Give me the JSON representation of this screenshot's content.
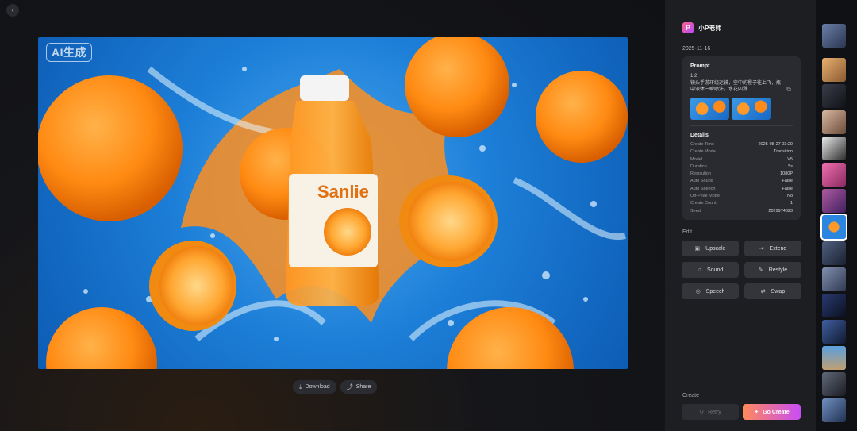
{
  "stage": {
    "watermark": "AI生成",
    "actions": [
      {
        "label": "Download",
        "icon": "download-icon"
      },
      {
        "label": "Share",
        "icon": "share-icon"
      }
    ],
    "packaging": "Sanlie"
  },
  "panel": {
    "user_name": "小P老师",
    "date": "2025-11-16",
    "prompt": {
      "heading": "Prompt",
      "ratio": "1:2",
      "text": "镜头手游环绕运镜，空中的橙子往上飞，瓶中液体一瞬喷汁，水花四溅"
    },
    "details": {
      "heading": "Details",
      "rows": [
        {
          "k": "Create Time",
          "v": "2025-08-27 03:20"
        },
        {
          "k": "Create Mode",
          "v": "Transition"
        },
        {
          "k": "Model",
          "v": "V5"
        },
        {
          "k": "Duration",
          "v": "5s"
        },
        {
          "k": "Resolution",
          "v": "1080P"
        },
        {
          "k": "Auto Sound",
          "v": "False"
        },
        {
          "k": "Auto Speech",
          "v": "False"
        },
        {
          "k": "Off-Peak Mode",
          "v": "No"
        },
        {
          "k": "Create Count",
          "v": "1"
        },
        {
          "k": "Seed",
          "v": "2029974623"
        }
      ]
    },
    "edit": {
      "heading": "Edit",
      "buttons": [
        {
          "label": "Upscale",
          "icon": "upscale-icon"
        },
        {
          "label": "Extend",
          "icon": "extend-icon"
        },
        {
          "label": "Sound",
          "icon": "sound-icon"
        },
        {
          "label": "Restyle",
          "icon": "restyle-icon"
        },
        {
          "label": "Speech",
          "icon": "speech-icon"
        },
        {
          "label": "Swap",
          "icon": "swap-icon"
        }
      ]
    },
    "create": {
      "heading": "Create",
      "retry": "Retry",
      "go": "Go Create"
    }
  },
  "colors": {
    "accent_start": "#ff8a5a",
    "accent_end": "#c94cf5",
    "panel_bg": "#1d1e22"
  }
}
